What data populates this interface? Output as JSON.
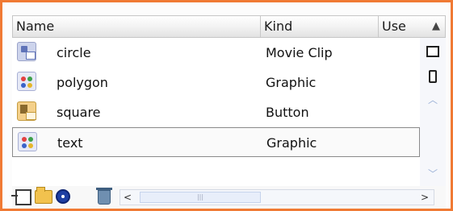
{
  "columns": {
    "name": "Name",
    "kind": "Kind",
    "use": "Use"
  },
  "sort_glyph": "▲",
  "items": [
    {
      "name": "circle",
      "kind": "Movie Clip",
      "icon": "movie-clip-symbol-icon"
    },
    {
      "name": "polygon",
      "kind": "Graphic",
      "icon": "graphic-symbol-icon"
    },
    {
      "name": "square",
      "kind": "Button",
      "icon": "button-symbol-icon"
    },
    {
      "name": "text",
      "kind": "Graphic",
      "icon": "graphic-symbol-icon",
      "selected": true
    }
  ],
  "scroll": {
    "up": "︿",
    "down": "﹀",
    "left": "<",
    "right": ">",
    "thumb": "|||"
  },
  "colors": {
    "frame": "#f07a34",
    "header_border": "#c6c6c6"
  }
}
